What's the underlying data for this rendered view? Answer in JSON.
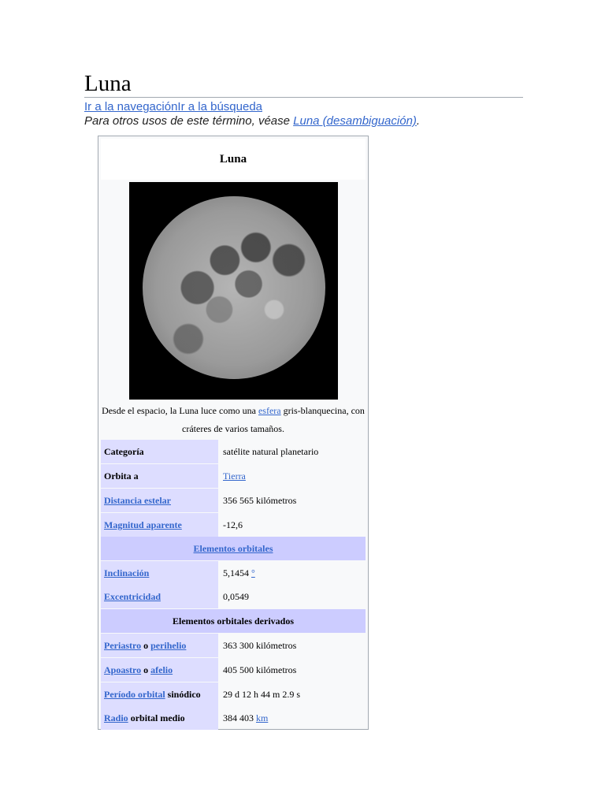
{
  "page": {
    "title": "Luna",
    "jump_nav": "Ir a la navegación",
    "jump_search": "Ir a la búsqueda",
    "hatnote_prefix": "Para otros usos de este término, véase ",
    "hatnote_link": "Luna (desambiguación)",
    "hatnote_suffix": "."
  },
  "infobox": {
    "title": "Luna",
    "caption_pre": "Desde el espacio, la Luna luce como una ",
    "caption_link": "esfera",
    "caption_post": " gris-blanquecina, con cráteres de varios tamaños.",
    "rows": [
      {
        "label": "Categoría",
        "value": "satélite natural planetario"
      },
      {
        "label": "Orbita a",
        "value": "Tierra"
      },
      {
        "label": "Distancia estelar",
        "value": "356 565 kilómetros"
      },
      {
        "label": "Magnitud aparente",
        "value": "-12,6"
      }
    ],
    "header1": "Elementos orbitales",
    "rows2": [
      {
        "label": "Inclinación",
        "value": "5,1454 ",
        "unit": "°"
      },
      {
        "label": "Excentricidad",
        "value": "0,0549"
      }
    ],
    "header2": "Elementos orbitales derivados",
    "rows3": [
      {
        "l1": "Periastro",
        "mid": " o ",
        "l2": "perihelio",
        "value": "363 300 kilómetros"
      },
      {
        "l1": "Apoastro",
        "mid": " o ",
        "l2": "afelio",
        "value": "405 500 kilómetros"
      },
      {
        "l1": "Período orbital",
        "mid": " sinódico",
        "value": "29 d 12 h 44 m 2.9 s"
      },
      {
        "l1": "Radio",
        "mid": " orbital medio",
        "value": "384 403 ",
        "unit": "km"
      }
    ]
  }
}
